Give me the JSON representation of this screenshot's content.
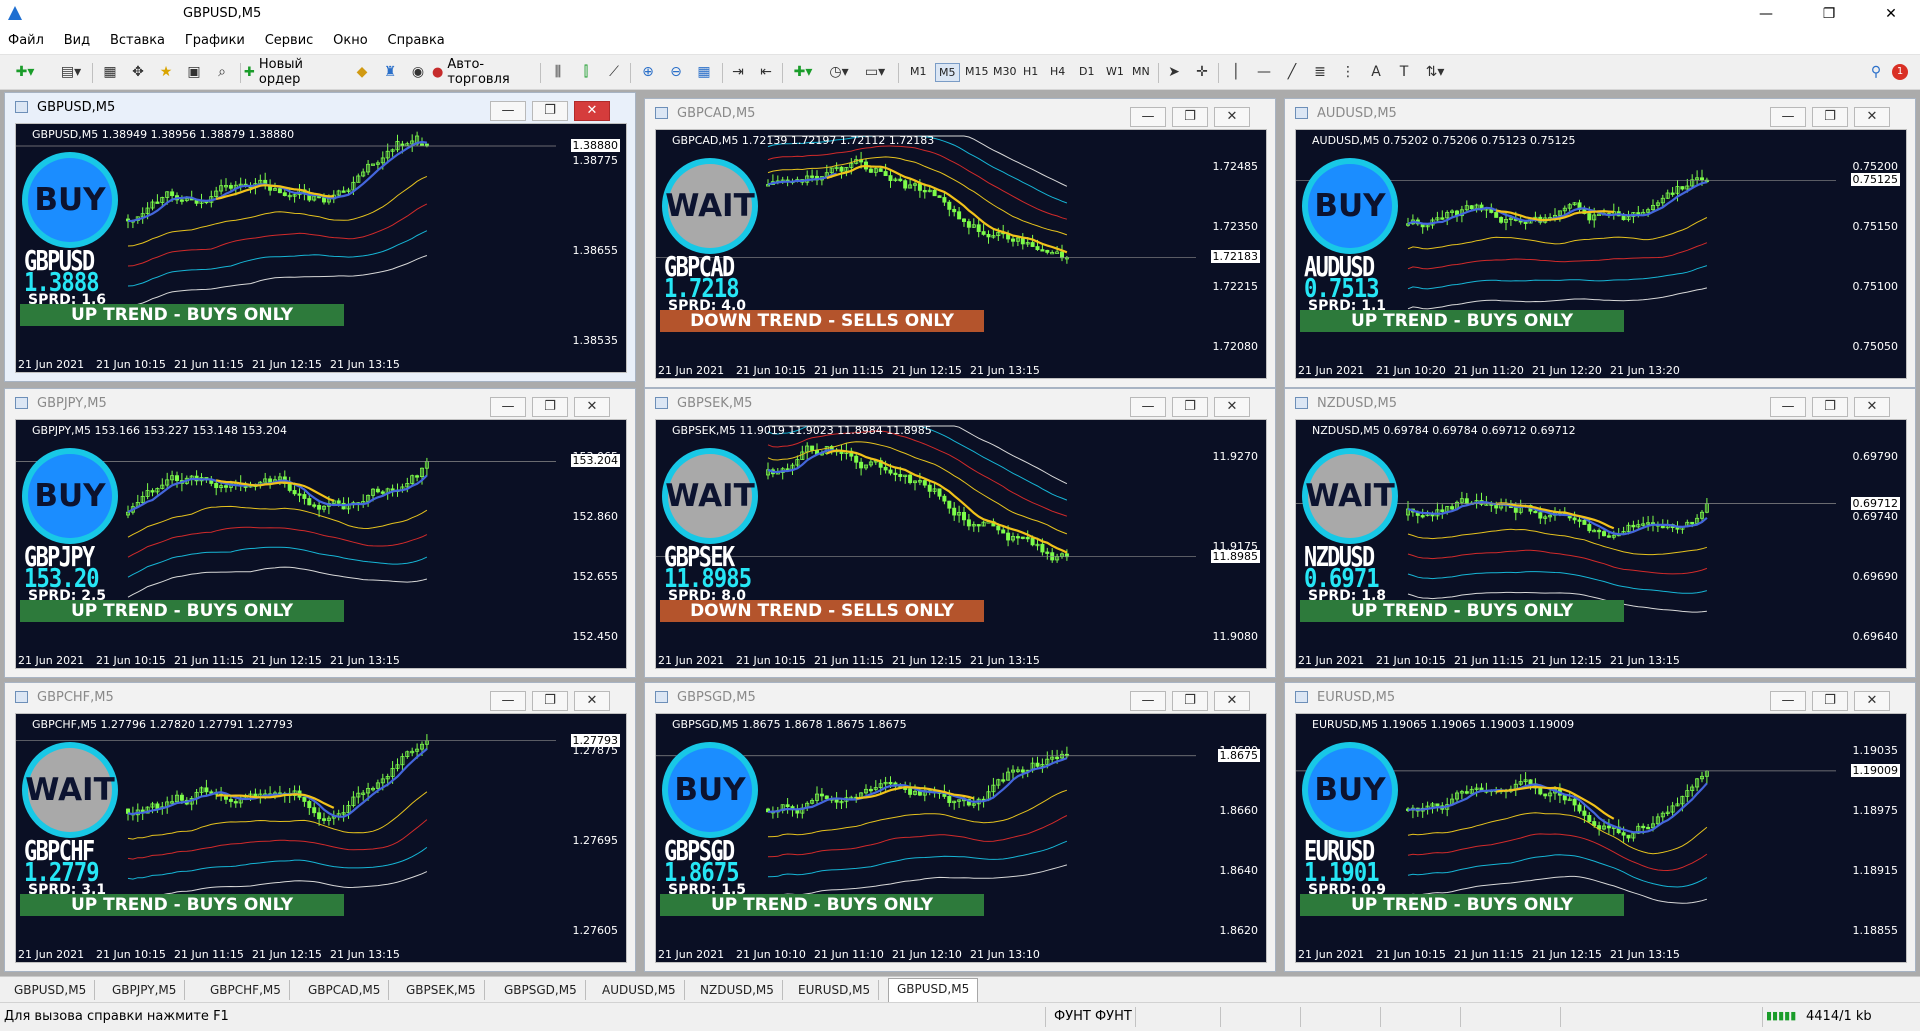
{
  "window": {
    "title": "GBPUSD,M5"
  },
  "menu": [
    "Файл",
    "Вид",
    "Вставка",
    "Графики",
    "Сервис",
    "Окно",
    "Справка"
  ],
  "toolbar": {
    "new_order": "Новый ордер",
    "auto_trading": "Авто-торговля",
    "timeframes": [
      "M1",
      "M5",
      "M15",
      "M30",
      "H1",
      "H4",
      "D1",
      "W1",
      "MN"
    ],
    "active_timeframe": "M5",
    "notification_count": "1"
  },
  "charts": [
    {
      "title": "GBPUSD,M5",
      "info": "GBPUSD,M5  1.38949 1.38956 1.38879 1.38880",
      "signal": "BUY",
      "symbol": "GBPUSD",
      "price": "1.3888",
      "spread": "SPRD: 1.6",
      "trend": "UP TREND - BUYS ONLY",
      "trend_dir": "up",
      "yticks": [
        "1.38775",
        "1.38655",
        "1.38535"
      ],
      "current": "1.38880",
      "xticks": [
        "21 Jun 2021",
        "21 Jun 10:15",
        "21 Jun 11:15",
        "21 Jun 12:15",
        "21 Jun 13:15"
      ],
      "active": true
    },
    {
      "title": "GBPCAD,M5",
      "info": "GBPCAD,M5  1.72139 1.72197 1.72112 1.72183",
      "signal": "WAIT",
      "symbol": "GBPCAD",
      "price": "1.7218",
      "spread": "SPRD: 4.0",
      "trend": "DOWN TREND - SELLS ONLY",
      "trend_dir": "down",
      "yticks": [
        "1.72485",
        "1.72350",
        "1.72215",
        "1.72080"
      ],
      "current": "1.72183",
      "xticks": [
        "21 Jun 2021",
        "21 Jun 10:15",
        "21 Jun 11:15",
        "21 Jun 12:15",
        "21 Jun 13:15"
      ],
      "active": false
    },
    {
      "title": "AUDUSD,M5",
      "info": "AUDUSD,M5  0.75202 0.75206 0.75123 0.75125",
      "signal": "BUY",
      "symbol": "AUDUSD",
      "price": "0.7513",
      "spread": "SPRD: 1.1",
      "trend": "UP TREND - BUYS ONLY",
      "trend_dir": "up",
      "yticks": [
        "0.75200",
        "0.75150",
        "0.75100",
        "0.75050"
      ],
      "current": "0.75125",
      "xticks": [
        "21 Jun 2021",
        "21 Jun 10:20",
        "21 Jun 11:20",
        "21 Jun 12:20",
        "21 Jun 13:20"
      ],
      "active": false
    },
    {
      "title": "GBPJPY,M5",
      "info": "GBPJPY,M5  153.166 153.227 153.148 153.204",
      "signal": "BUY",
      "symbol": "GBPJPY",
      "price": "153.20",
      "spread": "SPRD: 2.5",
      "trend": "UP TREND - BUYS ONLY",
      "trend_dir": "up",
      "yticks": [
        "153.065",
        "152.860",
        "152.655",
        "152.450"
      ],
      "current": "153.204",
      "xticks": [
        "21 Jun 2021",
        "21 Jun 10:15",
        "21 Jun 11:15",
        "21 Jun 12:15",
        "21 Jun 13:15"
      ],
      "active": false
    },
    {
      "title": "GBPSEK,M5",
      "info": "GBPSEK,M5  11.9019 11.9023 11.8984 11.8985",
      "signal": "WAIT",
      "symbol": "GBPSEK",
      "price": "11.8985",
      "spread": "SPRD: 8.0",
      "trend": "DOWN TREND - SELLS ONLY",
      "trend_dir": "down",
      "yticks": [
        "11.9270",
        "11.9175",
        "11.9080"
      ],
      "current": "11.8985",
      "xticks": [
        "21 Jun 2021",
        "21 Jun 10:15",
        "21 Jun 11:15",
        "21 Jun 12:15",
        "21 Jun 13:15"
      ],
      "active": false
    },
    {
      "title": "NZDUSD,M5",
      "info": "NZDUSD,M5  0.69784 0.69784 0.69712 0.69712",
      "signal": "WAIT",
      "symbol": "NZDUSD",
      "price": "0.6971",
      "spread": "SPRD: 1.8",
      "trend": "UP TREND - BUYS ONLY",
      "trend_dir": "up",
      "yticks": [
        "0.69790",
        "0.69740",
        "0.69690",
        "0.69640"
      ],
      "current": "0.69712",
      "xticks": [
        "21 Jun 2021",
        "21 Jun 10:15",
        "21 Jun 11:15",
        "21 Jun 12:15",
        "21 Jun 13:15"
      ],
      "active": false
    },
    {
      "title": "GBPCHF,M5",
      "info": "GBPCHF,M5  1.27796 1.27820 1.27791 1.27793",
      "signal": "WAIT",
      "symbol": "GBPCHF",
      "price": "1.2779",
      "spread": "SPRD: 3.1",
      "trend": "UP TREND - BUYS ONLY",
      "trend_dir": "up",
      "yticks": [
        "1.27875",
        "1.27695",
        "1.27605"
      ],
      "current": "1.27793",
      "xticks": [
        "21 Jun 2021",
        "21 Jun 10:15",
        "21 Jun 11:15",
        "21 Jun 12:15",
        "21 Jun 13:15"
      ],
      "active": false
    },
    {
      "title": "GBPSGD,M5",
      "info": "GBPSGD,M5  1.8675 1.8678 1.8675 1.8675",
      "signal": "BUY",
      "symbol": "GBPSGD",
      "price": "1.8675",
      "spread": "SPRD: 1.5",
      "trend": "UP TREND - BUYS ONLY",
      "trend_dir": "up",
      "yticks": [
        "1.8680",
        "1.8660",
        "1.8640",
        "1.8620"
      ],
      "current": "1.8675",
      "xticks": [
        "21 Jun 2021",
        "21 Jun 10:10",
        "21 Jun 11:10",
        "21 Jun 12:10",
        "21 Jun 13:10"
      ],
      "active": false
    },
    {
      "title": "EURUSD,M5",
      "info": "EURUSD,M5  1.19065 1.19065 1.19003 1.19009",
      "signal": "BUY",
      "symbol": "EURUSD",
      "price": "1.1901",
      "spread": "SPRD: 0.9",
      "trend": "UP TREND - BUYS ONLY",
      "trend_dir": "up",
      "yticks": [
        "1.19035",
        "1.18975",
        "1.18915",
        "1.18855"
      ],
      "current": "1.19009",
      "xticks": [
        "21 Jun 2021",
        "21 Jun 10:15",
        "21 Jun 11:15",
        "21 Jun 12:15",
        "21 Jun 13:15"
      ],
      "active": false
    }
  ],
  "tabs": [
    "GBPUSD,M5",
    "GBPJPY,M5",
    "GBPCHF,M5",
    "GBPCAD,M5",
    "GBPSEK,M5",
    "GBPSGD,M5",
    "AUDUSD,M5",
    "NZDUSD,M5",
    "EURUSD,M5",
    "GBPUSD,M5"
  ],
  "active_tab": 9,
  "status": {
    "help": "Для вызова справки нажмите F1",
    "profile": "ФУНТ ФУНТ",
    "traffic": "4414/1 kb"
  },
  "colors": {
    "chart_bg": "#0a0f24",
    "candle": "#7dfc4a",
    "ma_fast": "#4466dd",
    "ma_yellow": "#f2c21a",
    "buy": "#1b8dff",
    "wait": "#a9a9a9",
    "up_trend": "#2d7a3b",
    "down_trend": "#b4542c"
  }
}
